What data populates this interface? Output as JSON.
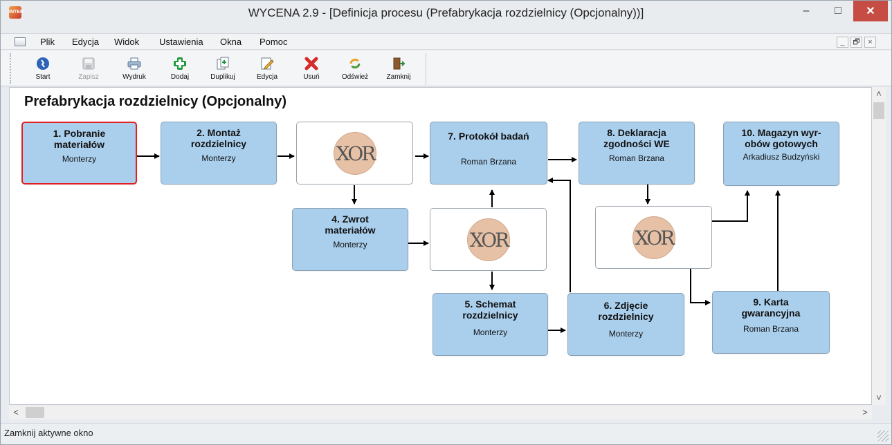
{
  "window": {
    "title": "WYCENA 2.9 - [Definicja procesu (Prefabrykacja rozdzielnicy (Opcjonalny))]",
    "app_icon_text": "INTER",
    "buttons": [
      "minimize-icon",
      "maximize-icon",
      "close-icon"
    ]
  },
  "menubar": {
    "items": [
      "Plik",
      "Edycja",
      "Widok",
      "Ustawienia",
      "Okna",
      "Pomoc"
    ],
    "mdi_buttons": [
      "_",
      "🗗",
      "×"
    ]
  },
  "toolbar": {
    "items": [
      {
        "label": "Start",
        "icon": "start-icon",
        "enabled": true
      },
      {
        "label": "Zapisz",
        "icon": "save-icon",
        "enabled": false
      },
      {
        "label": "Wydruk",
        "icon": "print-icon",
        "enabled": true
      },
      {
        "label": "Dodaj",
        "icon": "add-icon",
        "enabled": true
      },
      {
        "label": "Duplikuj",
        "icon": "duplicate-icon",
        "enabled": true
      },
      {
        "label": "Edycja",
        "icon": "edit-icon",
        "enabled": true
      },
      {
        "label": "Usuń",
        "icon": "delete-icon",
        "enabled": true
      },
      {
        "label": "Odśwież",
        "icon": "refresh-icon",
        "enabled": true
      },
      {
        "label": "Zamknij",
        "icon": "exit-door-icon",
        "enabled": true
      }
    ]
  },
  "diagram": {
    "title": "Prefabrykacja rozdzielnicy (Opcjonalny)",
    "gate_label": "XOR",
    "nodes": [
      {
        "id": "1",
        "name": "1. Pobranie materiałów",
        "who": "Monterzy",
        "selected": true
      },
      {
        "id": "2",
        "name": "2. Montaż rozdzielnicy",
        "who": "Monterzy"
      },
      {
        "id": "4",
        "name": "4. Zwrot materiałów",
        "who": "Monterzy"
      },
      {
        "id": "5",
        "name": "5. Schemat rozdzielnicy",
        "who": "Monterzy"
      },
      {
        "id": "6",
        "name": "6. Zdjęcie rozdzielnicy",
        "who": "Monterzy"
      },
      {
        "id": "7",
        "name": "7. Protokół badań",
        "who": "Roman Brzana"
      },
      {
        "id": "8",
        "name": "8. Deklaracja zgodności WE",
        "who": "Roman Brzana"
      },
      {
        "id": "9",
        "name": "9. Karta gwarancyjna",
        "who": "Roman Brzana"
      },
      {
        "id": "10",
        "name": "10. Magazyn wyr-obów gotowych",
        "who": "Arkadiusz Budzyński"
      }
    ],
    "colors": {
      "node_fill": "#aacfed",
      "selected_border": "#e21f22",
      "gate_coin": "#e7c1a6"
    }
  },
  "statusbar": {
    "text": "Zamknij aktywne okno"
  }
}
